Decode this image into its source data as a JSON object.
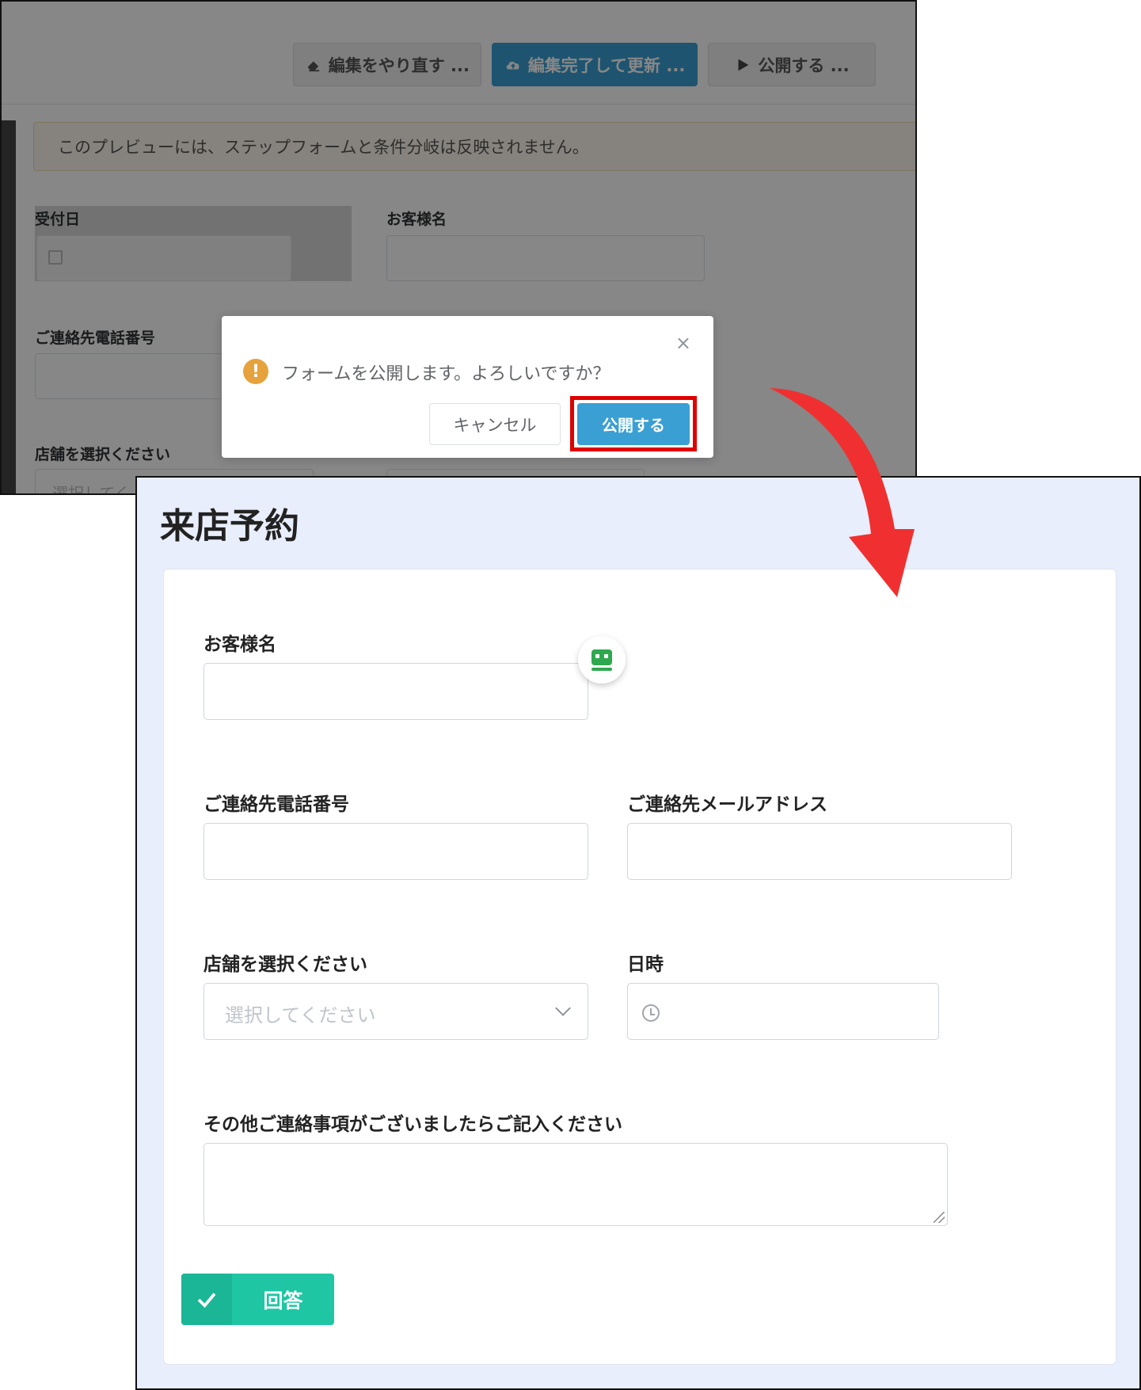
{
  "editor": {
    "toolbar": {
      "redo_label": "編集をやり直す ...",
      "update_label": "編集完了して更新 ...",
      "publish_label": "公開する ..."
    },
    "notice": "このプレビューには、ステップフォームと条件分岐は反映されません。",
    "fields": {
      "reception_date": "受付日",
      "customer_name": "お客様名",
      "phone": "ご連絡先電話番号",
      "store": "店舗を選択ください",
      "store_placeholder": "選択してく"
    }
  },
  "dialog": {
    "message": "フォームを公開します。よろしいですか？",
    "close_symbol": "×",
    "warning_symbol": "!",
    "cancel_label": "キャンセル",
    "confirm_label": "公開する"
  },
  "form": {
    "title": "来店予約",
    "fields": {
      "customer_name": "お客様名",
      "phone": "ご連絡先電話番号",
      "email": "ご連絡先メールアドレス",
      "store": "店舗を選択ください",
      "store_placeholder": "選択してください",
      "datetime": "日時",
      "notes": "その他ご連絡事項がございましたらご記入ください"
    },
    "submit_label": "回答"
  },
  "colors": {
    "primary_blue": "#3a9fd3",
    "highlight_red": "#e00000",
    "arrow_red": "#f03030",
    "submit_green": "#1fc6a3",
    "warning_orange": "#e6a23c",
    "form_background": "#e9eefc"
  },
  "icons": {
    "redo": "eraser-icon",
    "update": "cloud-upload-icon",
    "publish": "play-icon",
    "warning": "warning-icon",
    "close": "close-icon",
    "calendar": "calendar-icon",
    "clock": "clock-icon",
    "chevron": "chevron-down-icon",
    "check": "check-icon",
    "chat": "chatbot-icon",
    "arrow": "curved-arrow-icon"
  }
}
